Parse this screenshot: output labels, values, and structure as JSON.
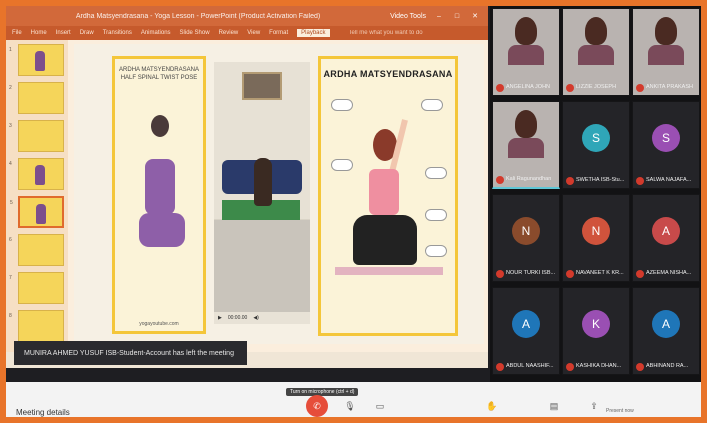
{
  "ppt": {
    "title": "Ardha Matsyendrasana - Yoga Lesson - PowerPoint (Product Activation Failed)",
    "context_tab": "Video Tools",
    "ribbon_tabs": [
      "File",
      "Home",
      "Insert",
      "Draw",
      "Transitions",
      "Animations",
      "Slide Show",
      "Review",
      "View",
      "Format",
      "Playback"
    ],
    "active_tab": "Playback",
    "tell_me": "Tell me what you want to do",
    "slide_numbers": [
      "1",
      "2",
      "3",
      "4",
      "5",
      "6",
      "7",
      "8"
    ]
  },
  "slide": {
    "card1_title": "ARDHA MATSYENDRASANA\nHALF SPINAL TWIST POSE",
    "card1_footer": "yogayoutube.com",
    "card2_title": "ARDHA MATSYENDRASANA",
    "video_time": "00:00.00"
  },
  "notice": "MUNIRA AHMED YUSUF ISB-Student-Account has left the meeting",
  "participants": [
    {
      "name": "ANGELINA JOHN",
      "initial": "",
      "color": "",
      "type": "video"
    },
    {
      "name": "LIZZIE JOSEPH",
      "initial": "",
      "color": "",
      "type": "video"
    },
    {
      "name": "ANKITA PRAKASH",
      "initial": "",
      "color": "",
      "type": "video"
    },
    {
      "name": "Kali Ragunandhan",
      "initial": "",
      "color": "",
      "type": "video"
    },
    {
      "name": "SWETHA ISB-Stu...",
      "initial": "S",
      "color": "#2fa6b8",
      "type": "avatar"
    },
    {
      "name": "SALWA NAJAFA...",
      "initial": "S",
      "color": "#9a4fb3",
      "type": "avatar"
    },
    {
      "name": "NOUR TURKI ISB...",
      "initial": "N",
      "color": "#8a4b2c",
      "type": "avatar"
    },
    {
      "name": "NAVANEET K KR...",
      "initial": "N",
      "color": "#d0533c",
      "type": "avatar"
    },
    {
      "name": "AZEEMA NISHA...",
      "initial": "A",
      "color": "#c84a4a",
      "type": "avatar"
    },
    {
      "name": "ABDUL NAASHIF...",
      "initial": "A",
      "color": "#1f76b8",
      "type": "avatar"
    },
    {
      "name": "KASHIKA DHAN...",
      "initial": "K",
      "color": "#9a4fb3",
      "type": "avatar"
    },
    {
      "name": "ABHINAND RA...",
      "initial": "A",
      "color": "#1f76b8",
      "type": "avatar"
    }
  ],
  "controls": {
    "meeting_name": "Meeting details",
    "tooltip": "Turn on microphone (ctrl + d)",
    "present_label": "Present now"
  },
  "colors": {
    "accent": "#d2693a",
    "frame": "#e8742a",
    "hangup": "#e64d3a"
  }
}
